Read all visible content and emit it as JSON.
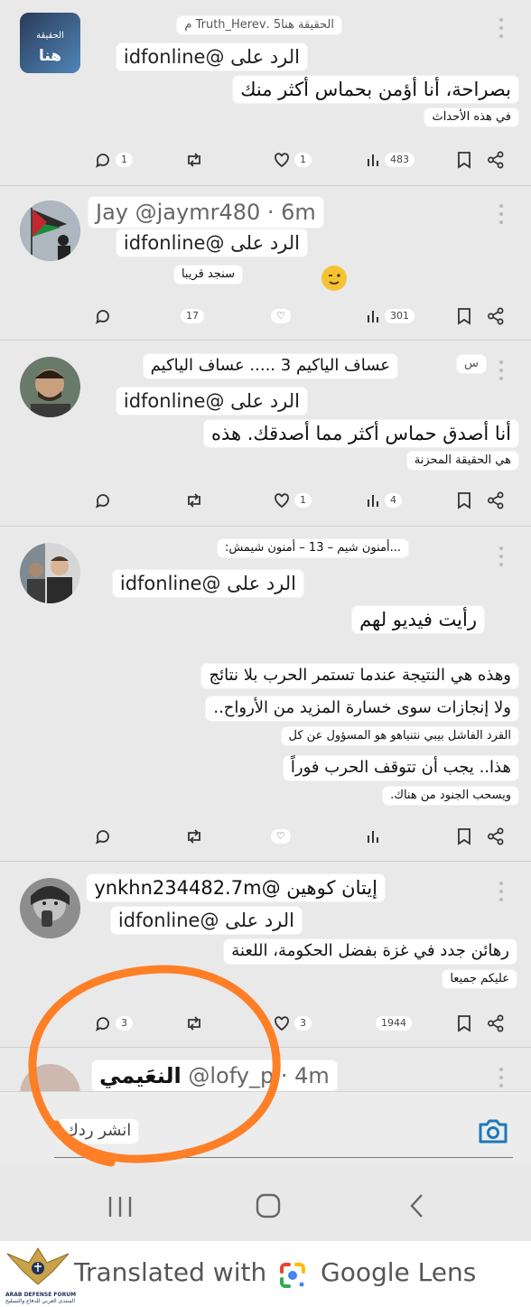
{
  "posts": [
    {
      "avatar_text_top": "الحقيقة",
      "avatar_text_bottom": "هنا",
      "header": "الحقيقة هنا5 .Truth_Herev م",
      "reply_to": "الرد على @idfonline",
      "lines": [
        "بصراحة، أنا أؤمن بحماس أكثر منك",
        "في هذه الأحداث"
      ],
      "counts": {
        "replies": "1",
        "likes": "1",
        "views": "483"
      }
    },
    {
      "header": "Jay @jaymr480 · 6m",
      "reply_to": "الرد على @idfonline",
      "lines": [
        "سنجد قريبا"
      ],
      "counts": {
        "retweets": "17",
        "views": "301"
      }
    },
    {
      "header_badge": "س",
      "header": "عساف الياكيم 3 ..... عساف الياكيم",
      "reply_to": "الرد على @idfonline",
      "lines": [
        "أنا أصدق حماس أكثر مما أصدقك. هذه",
        "هي الحقيقة المحزنة"
      ],
      "counts": {
        "likes": "1",
        "views": "4"
      }
    },
    {
      "header": "...أمنون شيم – 13 – أمنون شيمش:",
      "reply_to": "الرد على @idfonline",
      "lines": [
        "رأيت فيديو لهم",
        "وهذه هي النتيجة عندما تستمر الحرب بلا نتائج",
        "ولا إنجازات سوى خسارة المزيد من الأرواح..",
        "القرد الفاشل بيبي نتنياهو هو المسؤول عن كل",
        "هذا.. يجب أن تتوقف الحرب فوراً",
        "ويسحب الجنود من هناك."
      ]
    },
    {
      "header": "إيتان كوهين @ynkhn234482.7m",
      "reply_to": "الرد على @idfonline",
      "lines": [
        "رهائن جدد في غزة بفضل الحكومة، اللعنة",
        "عليكم جميعا"
      ],
      "counts": {
        "replies": "3",
        "likes": "3",
        "views": "1944"
      }
    },
    {
      "header_name": "النعَيمي",
      "header_handle": "@lofy_p · 4m"
    }
  ],
  "compose": {
    "placeholder": "انشر ردك"
  },
  "icons": [
    "reply-icon",
    "retweet-icon",
    "like-icon",
    "views-icon",
    "bookmark-icon",
    "share-icon",
    "camera-icon",
    "recents-icon",
    "home-icon",
    "back-icon",
    "more-icon"
  ],
  "watermark": {
    "text": "Translated with",
    "brand": "Google Lens",
    "logo_title": "ARAB DEFENSE FORUM",
    "logo_sub": "المنتدى العربي للدفاع والتسليح"
  },
  "colors": {
    "background": "#e9e9ea",
    "accent": "#1d7ab8",
    "annotation": "#ff7f27"
  }
}
